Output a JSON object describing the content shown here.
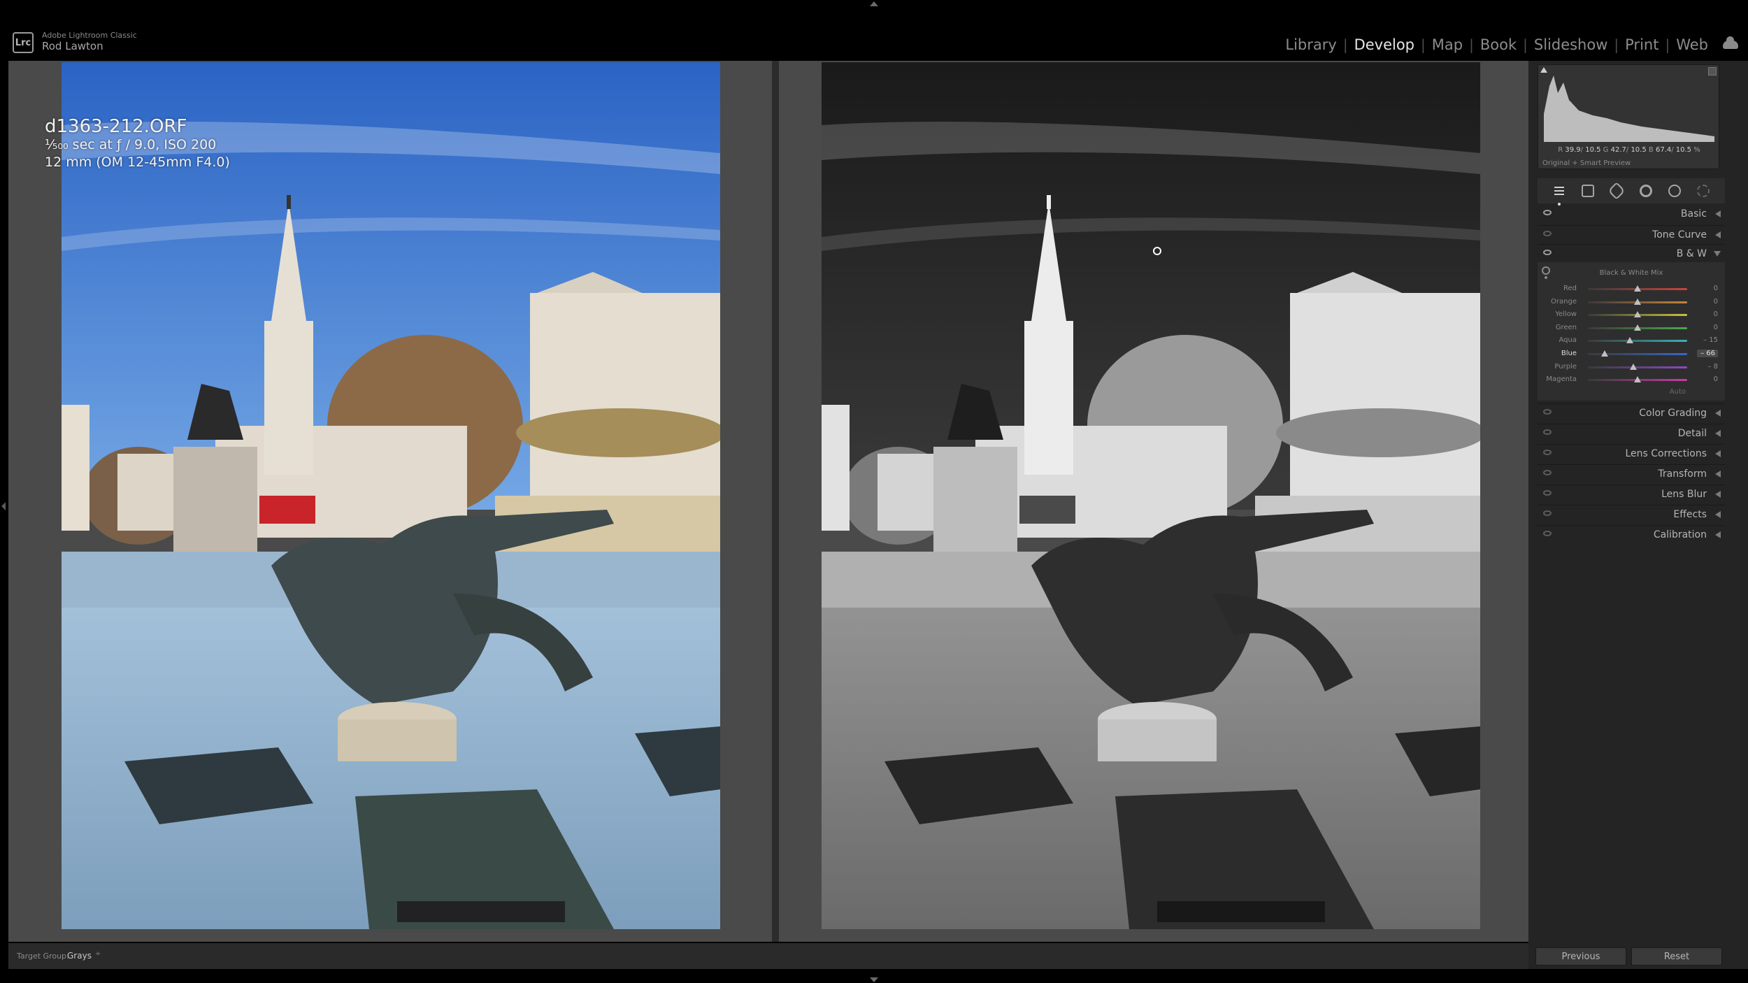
{
  "app": {
    "name": "Adobe Lightroom Classic",
    "user": "Rod Lawton",
    "logo": "Lrc"
  },
  "modules": [
    {
      "label": "Library",
      "active": false
    },
    {
      "label": "Develop",
      "active": true
    },
    {
      "label": "Map",
      "active": false
    },
    {
      "label": "Book",
      "active": false
    },
    {
      "label": "Slideshow",
      "active": false
    },
    {
      "label": "Print",
      "active": false
    },
    {
      "label": "Web",
      "active": false
    }
  ],
  "photo_info": {
    "file_name": "d1363-212.ORF",
    "exposure": "¹⁄₅₀₀ sec at ƒ / 9.0, ISO 200",
    "lens": "12 mm (OM 12-45mm F4.0)"
  },
  "toolbar": {
    "target_group_label": "Target Group:",
    "target_group_value": "Grays",
    "target_group_arrow": "÷"
  },
  "histogram": {
    "r_label": "R",
    "r_value": "39.9",
    "g_label": "G",
    "g_value": "42.7",
    "b_label": "B",
    "b_value": "67.4",
    "sep_value": "10.5",
    "unit": "%",
    "preview_status": "Original + Smart Preview"
  },
  "panels": {
    "basic": "Basic",
    "tone_curve": "Tone Curve",
    "bw": "B & W",
    "color_grading": "Color Grading",
    "detail": "Detail",
    "lens_corrections": "Lens Corrections",
    "transform": "Transform",
    "lens_blur": "Lens Blur",
    "effects": "Effects",
    "calibration": "Calibration"
  },
  "bw_mix": {
    "title": "Black & White Mix",
    "auto_label": "Auto",
    "channels": [
      {
        "label": "Red",
        "value": "0",
        "num": 0,
        "active": false,
        "color": "#c8453a"
      },
      {
        "label": "Orange",
        "value": "0",
        "num": 0,
        "active": false,
        "color": "#c8843a"
      },
      {
        "label": "Yellow",
        "value": "0",
        "num": 0,
        "active": false,
        "color": "#c8c23a"
      },
      {
        "label": "Green",
        "value": "0",
        "num": 0,
        "active": false,
        "color": "#4ca84a"
      },
      {
        "label": "Aqua",
        "value": "– 15",
        "num": -15,
        "active": false,
        "color": "#3ab2b8"
      },
      {
        "label": "Blue",
        "value": "– 66",
        "num": -66,
        "active": true,
        "color": "#3a66c8"
      },
      {
        "label": "Purple",
        "value": "– 8",
        "num": -8,
        "active": false,
        "color": "#8a4ac8"
      },
      {
        "label": "Magenta",
        "value": "0",
        "num": 0,
        "active": false,
        "color": "#c83aa8"
      }
    ]
  },
  "buttons": {
    "previous": "Previous",
    "reset": "Reset"
  }
}
